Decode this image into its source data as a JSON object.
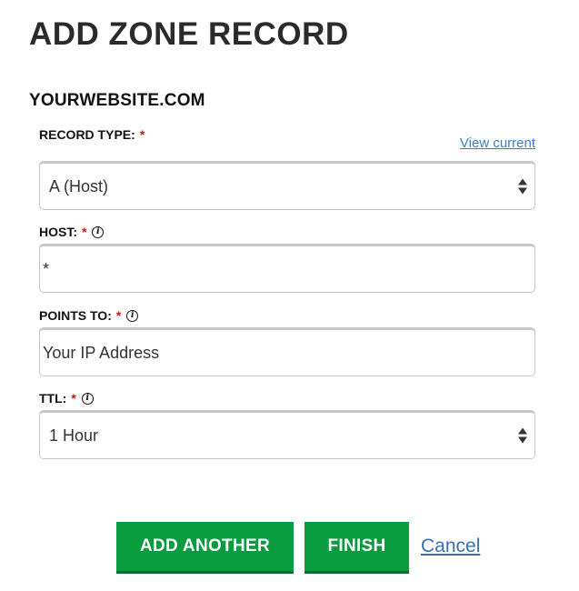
{
  "page": {
    "title": "ADD ZONE RECORD",
    "domain": "YOURWEBSITE.COM"
  },
  "form": {
    "record_type": {
      "label": "RECORD TYPE:",
      "required": "*",
      "value": "A (Host)",
      "view_current": "View current"
    },
    "host": {
      "label": "HOST:",
      "required": "*",
      "info": "i",
      "value": "*"
    },
    "points_to": {
      "label": "POINTS TO:",
      "required": "*",
      "info": "i",
      "value": "Your IP Address"
    },
    "ttl": {
      "label": "TTL:",
      "required": "*",
      "info": "i",
      "value": "1 Hour"
    }
  },
  "actions": {
    "add_another": "ADD ANOTHER",
    "finish": "FINISH",
    "cancel": "Cancel"
  },
  "colors": {
    "primary_button": "#0a9b3f",
    "link": "#3b7dc7",
    "required": "#c41a1a"
  }
}
